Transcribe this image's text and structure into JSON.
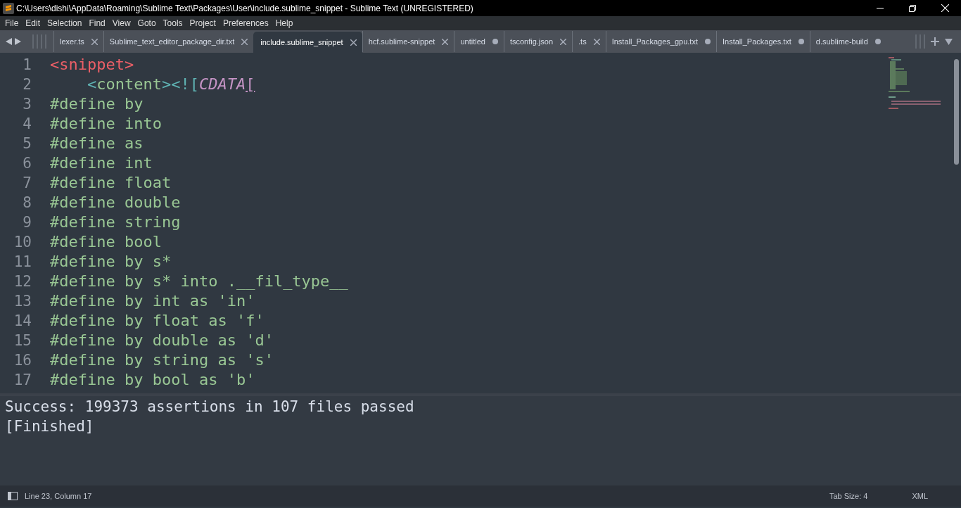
{
  "window": {
    "title": "C:\\Users\\dishi\\AppData\\Roaming\\Sublime Text\\Packages\\User\\include.sublime_snippet - Sublime Text (UNREGISTERED)"
  },
  "menu": [
    "File",
    "Edit",
    "Selection",
    "Find",
    "View",
    "Goto",
    "Tools",
    "Project",
    "Preferences",
    "Help"
  ],
  "tabs": [
    {
      "label": "lexer.ts",
      "kind": "saved",
      "selected": false
    },
    {
      "label": "Sublime_text_editor_package_dir.txt",
      "kind": "saved",
      "selected": false
    },
    {
      "label": "include.sublime_snippet",
      "kind": "saved",
      "selected": true
    },
    {
      "label": "hcf.sublime-snippet",
      "kind": "saved",
      "selected": false
    },
    {
      "label": "untitled",
      "kind": "dirty",
      "selected": false
    },
    {
      "label": "tsconfig.json",
      "kind": "saved",
      "selected": false
    },
    {
      "label": ".ts",
      "kind": "saved",
      "selected": false
    },
    {
      "label": "Install_Packages_gpu.txt",
      "kind": "dirty",
      "selected": false
    },
    {
      "label": "Install_Packages.txt",
      "kind": "dirty",
      "selected": false
    },
    {
      "label": "d.sublime-build",
      "kind": "dirty",
      "selected": false
    }
  ],
  "editor": {
    "lines": [
      {
        "number": "1",
        "tokens": [
          {
            "text": "<snippet>",
            "kind": "tag"
          }
        ]
      },
      {
        "number": "2",
        "tokens": [
          {
            "text": "    <",
            "kind": "punct"
          },
          {
            "text": "content",
            "kind": "name"
          },
          {
            "text": "><![",
            "kind": "punct"
          },
          {
            "text": "CDATA",
            "kind": "cdata"
          },
          {
            "text": "[",
            "kind": "bracket"
          }
        ]
      },
      {
        "number": "3",
        "tokens": [
          {
            "text": "#define by",
            "kind": "define"
          }
        ]
      },
      {
        "number": "4",
        "tokens": [
          {
            "text": "#define into",
            "kind": "define"
          }
        ]
      },
      {
        "number": "5",
        "tokens": [
          {
            "text": "#define as",
            "kind": "define"
          }
        ]
      },
      {
        "number": "6",
        "tokens": [
          {
            "text": "#define int",
            "kind": "define"
          }
        ]
      },
      {
        "number": "7",
        "tokens": [
          {
            "text": "#define float",
            "kind": "define"
          }
        ]
      },
      {
        "number": "8",
        "tokens": [
          {
            "text": "#define double",
            "kind": "define"
          }
        ]
      },
      {
        "number": "9",
        "tokens": [
          {
            "text": "#define string",
            "kind": "define"
          }
        ]
      },
      {
        "number": "10",
        "tokens": [
          {
            "text": "#define bool",
            "kind": "define"
          }
        ]
      },
      {
        "number": "11",
        "tokens": [
          {
            "text": "#define by s*",
            "kind": "define"
          }
        ]
      },
      {
        "number": "12",
        "tokens": [
          {
            "text": "#define by s* into .__fil_type__",
            "kind": "define"
          }
        ]
      },
      {
        "number": "13",
        "tokens": [
          {
            "text": "#define by int as 'in'",
            "kind": "define"
          }
        ]
      },
      {
        "number": "14",
        "tokens": [
          {
            "text": "#define by float as 'f'",
            "kind": "define"
          }
        ]
      },
      {
        "number": "15",
        "tokens": [
          {
            "text": "#define by double as 'd'",
            "kind": "define"
          }
        ]
      },
      {
        "number": "16",
        "tokens": [
          {
            "text": "#define by string as 's'",
            "kind": "define"
          }
        ]
      },
      {
        "number": "17",
        "tokens": [
          {
            "text": "#define by bool as 'b'",
            "kind": "define"
          }
        ]
      }
    ]
  },
  "output": [
    "Success: 199373 assertions in 107 files passed",
    "[Finished]"
  ],
  "status_bar": {
    "position": "Line 23, Column 17",
    "tab_size": "Tab Size: 4",
    "syntax": "XML"
  }
}
